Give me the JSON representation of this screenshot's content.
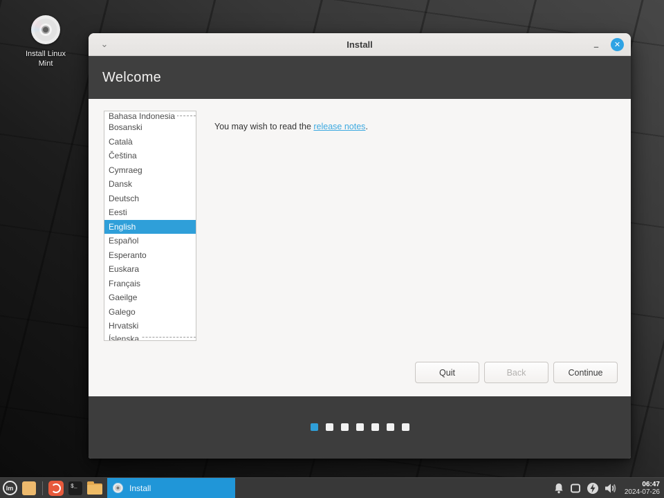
{
  "colors": {
    "accent_blue": "#2f9fd9",
    "close_button_blue": "#2fa3e4",
    "taskbar_button_blue": "#2096d8",
    "header_dark": "#3f3f3f",
    "footer_dark": "#3d3d3d",
    "taskbar_dark": "#383838"
  },
  "desktop": {
    "icon": {
      "label_line1": "Install Linux",
      "label_line2": "Mint"
    }
  },
  "window": {
    "title": "Install",
    "titlebar_glyphs": {
      "chevron": "⌄",
      "minimize": "–",
      "close": "✕"
    },
    "header": "Welcome",
    "notes": {
      "prefix": "You may wish to read the ",
      "link": "release notes",
      "suffix": "."
    },
    "language_list": {
      "partial_top": "Bahasa Indonesia",
      "items": [
        "Bosanski",
        "Català",
        "Čeština",
        "Cymraeg",
        "Dansk",
        "Deutsch",
        "Eesti",
        "English",
        "Español",
        "Esperanto",
        "Euskara",
        "Français",
        "Gaeilge",
        "Galego",
        "Hrvatski"
      ],
      "selected": "English",
      "partial_bottom": "Íslenska"
    },
    "buttons": [
      {
        "label": "Quit",
        "enabled": true
      },
      {
        "label": "Back",
        "enabled": false
      },
      {
        "label": "Continue",
        "enabled": true
      }
    ],
    "progress": {
      "total": 7,
      "current": 1
    }
  },
  "taskbar": {
    "menu_glyph": "lm",
    "terminal_glyph": "$_",
    "window_button_label": "Install",
    "clock": {
      "time": "06:47",
      "date": "2024-07-26"
    }
  }
}
